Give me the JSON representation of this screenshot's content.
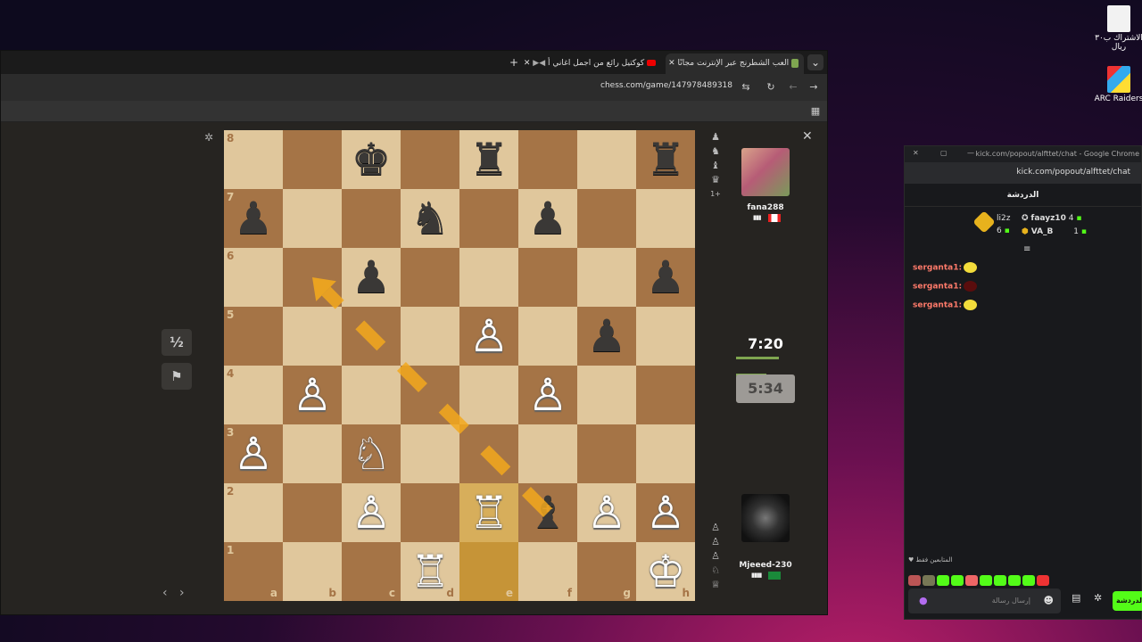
{
  "desktop": {
    "icons": [
      {
        "label": "الاشتراك ب٣٠ ريال",
        "icon": "document-icon"
      },
      {
        "label": "ARC Raiders",
        "icon": "arc-raiders-icon"
      }
    ]
  },
  "browser": {
    "tabs": [
      {
        "title": "العب الشطرنج عبر الإنترنت مجانًا"
      },
      {
        "title": "كوكتيل رائع من اجمل اغاني أ"
      }
    ],
    "url": "chess.com/game/147978489318"
  },
  "board": {
    "files": [
      "a",
      "b",
      "c",
      "d",
      "e",
      "f",
      "g",
      "h"
    ],
    "ranks": [
      "8",
      "7",
      "6",
      "5",
      "4",
      "3",
      "2",
      "1"
    ],
    "pieces": [
      {
        "sq": "c8",
        "glyph": "♚",
        "color": "b",
        "name": "black-king"
      },
      {
        "sq": "e8",
        "glyph": "♜",
        "color": "b",
        "name": "black-rook"
      },
      {
        "sq": "h8",
        "glyph": "♜",
        "color": "b",
        "name": "black-rook"
      },
      {
        "sq": "a7",
        "glyph": "♟",
        "color": "b",
        "name": "black-pawn"
      },
      {
        "sq": "d7",
        "glyph": "♞",
        "color": "b",
        "name": "black-knight"
      },
      {
        "sq": "f7",
        "glyph": "♟",
        "color": "b",
        "name": "black-pawn"
      },
      {
        "sq": "c6",
        "glyph": "♟",
        "color": "b",
        "name": "black-pawn"
      },
      {
        "sq": "h6",
        "glyph": "♟",
        "color": "b",
        "name": "black-pawn"
      },
      {
        "sq": "e5",
        "glyph": "♙",
        "color": "w",
        "name": "white-pawn"
      },
      {
        "sq": "g5",
        "glyph": "♟",
        "color": "b",
        "name": "black-pawn"
      },
      {
        "sq": "b4",
        "glyph": "♙",
        "color": "w",
        "name": "white-pawn"
      },
      {
        "sq": "f4",
        "glyph": "♙",
        "color": "w",
        "name": "white-pawn"
      },
      {
        "sq": "a3",
        "glyph": "♙",
        "color": "w",
        "name": "white-pawn"
      },
      {
        "sq": "c3",
        "glyph": "♘",
        "color": "w",
        "name": "white-knight"
      },
      {
        "sq": "c2",
        "glyph": "♙",
        "color": "w",
        "name": "white-pawn"
      },
      {
        "sq": "e2",
        "glyph": "♖",
        "color": "w",
        "name": "white-rook"
      },
      {
        "sq": "f2",
        "glyph": "♝",
        "color": "b",
        "name": "black-bishop"
      },
      {
        "sq": "g2",
        "glyph": "♙",
        "color": "w",
        "name": "white-pawn"
      },
      {
        "sq": "h2",
        "glyph": "♙",
        "color": "w",
        "name": "white-pawn"
      },
      {
        "sq": "d1",
        "glyph": "♖",
        "color": "w",
        "name": "white-rook"
      },
      {
        "sq": "h1",
        "glyph": "♔",
        "color": "w",
        "name": "white-king"
      }
    ],
    "highlighted": [
      "e2",
      "e1"
    ],
    "arrow": {
      "from": "f2",
      "to": "b6",
      "color": "#f2a81d"
    }
  },
  "game": {
    "draw_label": "½",
    "resign_icon": "flag-icon",
    "top_player": {
      "name": "fana288",
      "country_flag": "canada-flag-icon",
      "captures_extra": "1+"
    },
    "bottom_player": {
      "name": "Mjeeed-230",
      "country_flag": "saudi-flag-icon"
    },
    "top_clock": "7:20",
    "bottom_clock": "5:34"
  },
  "chat": {
    "window_title": "kick.com/popout/alfttet/chat - Google Chrome",
    "url": "kick.com/popout/alfttet/chat",
    "header": "الدردشة",
    "leaderboard": [
      {
        "name": "li2z",
        "value": "6"
      },
      {
        "name": "faayz10",
        "value": "4"
      },
      {
        "name": "VA_B",
        "value": "1"
      }
    ],
    "messages": [
      {
        "user": "serganta1:",
        "emote": "yellow"
      },
      {
        "user": "serganta1:",
        "emote": "red"
      },
      {
        "user": "serganta1:",
        "emote": "yellow"
      }
    ],
    "emotes_label": "المتابعين فقط",
    "input_placeholder": "إرسال رسالة",
    "send_label": "الدردشة"
  }
}
